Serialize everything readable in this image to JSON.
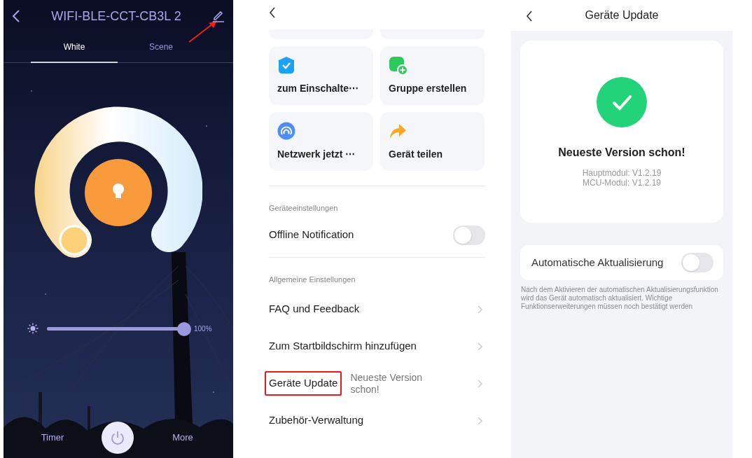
{
  "device_panel": {
    "title": "WIFI-BLE-CCT-CB3L 2",
    "tabs": [
      {
        "label": "White",
        "selected": true
      },
      {
        "label": "Scene",
        "selected": false
      }
    ],
    "brightness": {
      "level": 1,
      "reading": "100%"
    },
    "bottom_bar": {
      "left": "Timer",
      "right": "More"
    }
  },
  "settings_panel": {
    "tiles": [
      {
        "label": "zum Einschalte⋯"
      },
      {
        "label": "Gruppe erstellen"
      },
      {
        "label": "Netzwerk jetzt ⋯"
      },
      {
        "label": "Gerät teilen"
      }
    ],
    "sections": [
      {
        "heading": "Geräteeinstellungen",
        "rows": [
          {
            "kind": "toggle",
            "label": "Offline Notification",
            "on": false
          }
        ]
      },
      {
        "heading": "Allgemeine Einstellungen",
        "rows": [
          {
            "kind": "link",
            "label": "FAQ und Feedback",
            "highlighted": false
          },
          {
            "kind": "link",
            "label": "Zum Startbildschirm hinzufügen",
            "highlighted": false
          },
          {
            "kind": "link",
            "label": "Geräte Update",
            "value": "Neueste Version schon!",
            "highlighted": true
          },
          {
            "kind": "link",
            "label": "Zubehör-Verwaltung",
            "highlighted": false
          }
        ]
      }
    ]
  },
  "update_panel": {
    "title": "Geräte Update",
    "status": "Neueste Version schon!",
    "versions": [
      "Hauptmodul: V1.2.19",
      "MCU-Modul: V1.2.19"
    ],
    "auto_update": {
      "label": "Automatische Aktualisierung",
      "on": false
    },
    "note": "Nach dem Aktivieren der automatischen Aktualisierungsfunktion wird das Gerät automatisch aktualisiert. Wichtige Funktionserweiterungen müssen noch bestätigt werden"
  }
}
